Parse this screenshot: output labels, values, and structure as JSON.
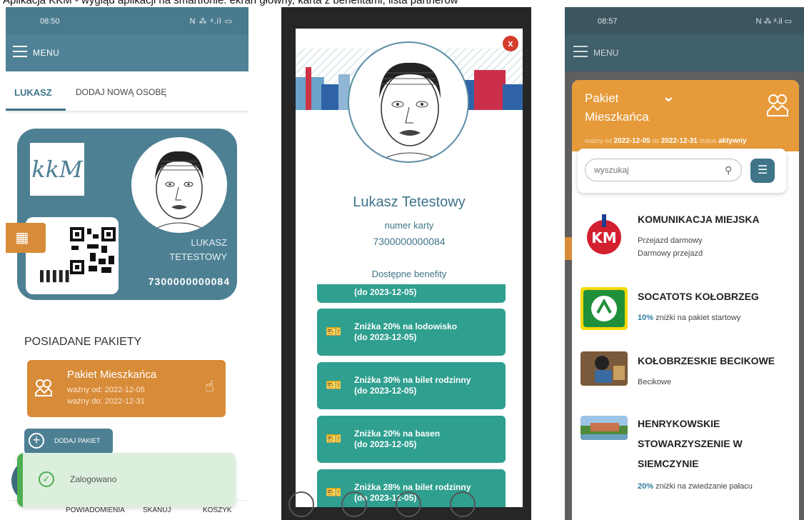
{
  "caption": "Aplikacja KKM - wygląd aplikacji na smartfonie: ekran główny, karta z benefitami, lista partnerów",
  "phone1": {
    "status_time": "08:50",
    "status_icons": "N ⁂ ᵃ.il ▭",
    "menu_label": "MENU",
    "tabs": [
      "LUKASZ",
      "DODAJ NOWĄ OSOBĘ"
    ],
    "logo_text": "kkM",
    "card_first_name": "LUKASZ",
    "card_last_name": "TETESTOWY",
    "card_number": "7300000000084",
    "section_title": "POSIADANE PAKIETY",
    "package": {
      "name": "Pakiet Mieszkańca",
      "valid_from": "ważny od: 2022-12-05",
      "valid_to": "ważny do: 2022-12-31"
    },
    "add_package": "DODAJ PAKIET",
    "toast": "Zalogowano",
    "nav": [
      "POWIADOMIENIA",
      "SKANUJ",
      "KOSZYK"
    ],
    "colors": {
      "primary": "#4e8094",
      "accent": "#d88b38",
      "success": "#4caf50"
    }
  },
  "phone2": {
    "close": "x",
    "name": "Lukasz Tetestowy",
    "card_label": "numer karty",
    "card_number": "7300000000084",
    "benefits_label": "Dostępne benefity",
    "benefits": [
      {
        "line1": "",
        "line2": "(do 2023-12-05)"
      },
      {
        "line1": "Zniżka 20% na lodowisko",
        "line2": "(do 2023-12-05)"
      },
      {
        "line1": "Zniżka 30% na bilet rodzinny",
        "line2": "(do 2023-12-05)"
      },
      {
        "line1": "Zniżka 20% na basen",
        "line2": "(do 2023-12-05)"
      },
      {
        "line1": "Zniżka 28% na bilet rodzinny",
        "line2": "(do 2023-12-05)"
      }
    ],
    "colors": {
      "benefit": "#2f9f8f"
    }
  },
  "phone3": {
    "status_time": "08:57",
    "status_icons": "N ⁂ ᵃ.il ▭",
    "menu_label": "MENU",
    "package_title_1": "Pakiet",
    "package_title_2": "Mieszkańca",
    "valid_from_label": "ważny od",
    "valid_from": "2022-12-05",
    "valid_to_label": "do",
    "valid_to": "2022-12-31",
    "status_label": "status",
    "status": "aktywny",
    "search_placeholder": "wyszukaj",
    "partners": [
      {
        "title": "KOMUNIKACJA MIEJSKA",
        "desc1": "Przejazd darmowy",
        "desc2": "Darmowy przejazd",
        "highlight": ""
      },
      {
        "title": "SOCATOTS KOŁOBRZEG",
        "desc1": "zniżki na pakiet startowy",
        "desc2": "",
        "highlight": "10%"
      },
      {
        "title": "KOŁOBRZESKIE BECIKOWE",
        "desc1": "Becikowe",
        "desc2": "",
        "highlight": ""
      },
      {
        "title_lines": [
          "HENRYKOWSKIE",
          "STOWARZYSZENIE W",
          "SIEMCZYNIE"
        ],
        "desc1": "zniżki na zwiedzanie pałacu",
        "desc2": "",
        "highlight": "20%"
      }
    ],
    "colors": {
      "header": "#e69a3a",
      "link": "#2f7e9c"
    }
  }
}
